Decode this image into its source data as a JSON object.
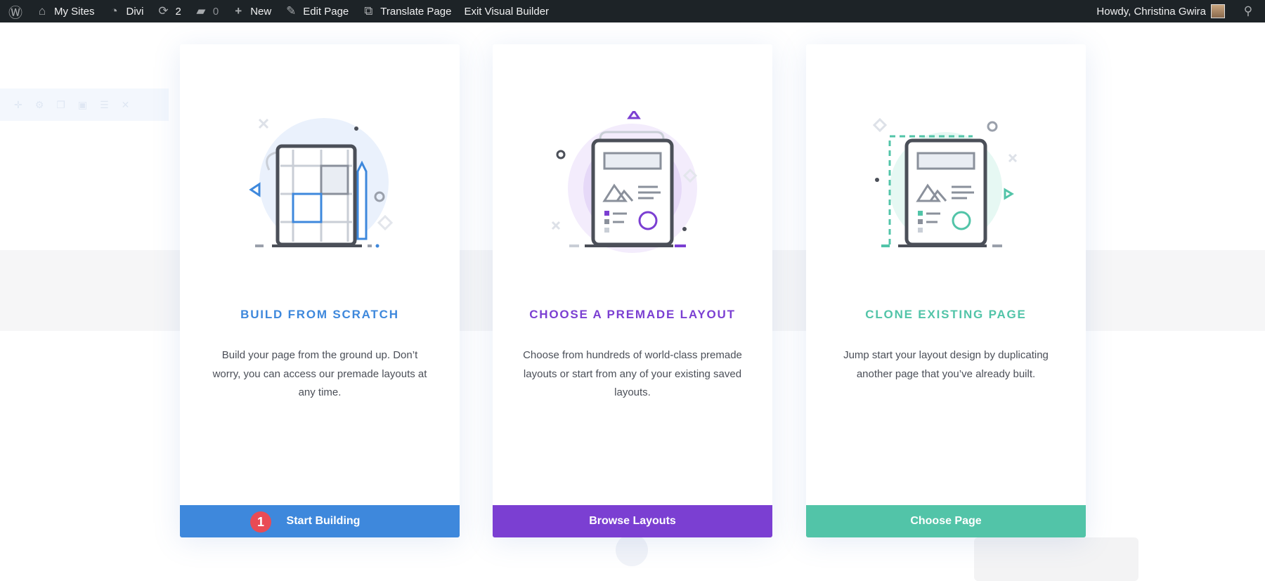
{
  "admin_bar": {
    "my_sites": "My Sites",
    "divi": "Divi",
    "updates_count": "2",
    "comments_count": "0",
    "new": "New",
    "edit_page": "Edit Page",
    "translate_page": "Translate Page",
    "exit_builder": "Exit Visual Builder",
    "howdy": "Howdy, Christina Gwira"
  },
  "cards": [
    {
      "title": "BUILD FROM SCRATCH",
      "description": "Build your page from the ground up. Don’t worry, you can access our premade layouts at any time.",
      "button": "Start Building",
      "color": "#3e88dc",
      "step_badge": "1"
    },
    {
      "title": "CHOOSE A PREMADE LAYOUT",
      "description": "Choose from hundreds of world-class premade layouts or start from any of your existing saved layouts.",
      "button": "Browse Layouts",
      "color": "#7b3fd2"
    },
    {
      "title": "CLONE EXISTING PAGE",
      "description": "Jump start your layout design by duplicating another page that you’ve already built.",
      "button": "Choose Page",
      "color": "#52c4a8"
    }
  ]
}
